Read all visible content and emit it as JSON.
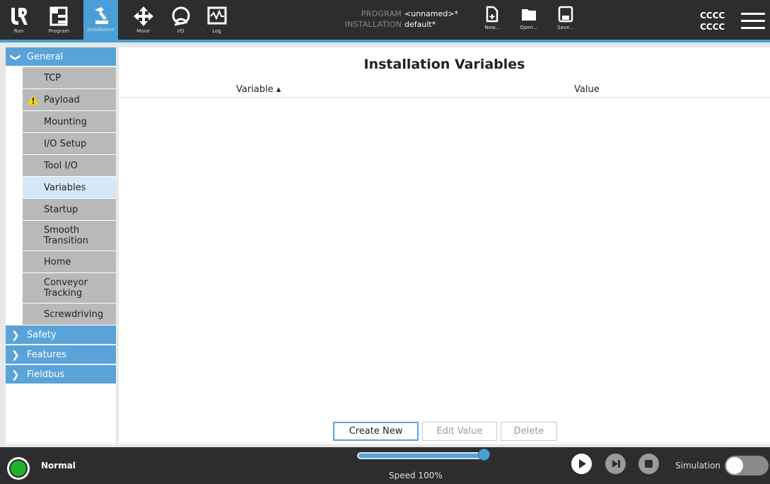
{
  "topbar": {
    "nav": [
      {
        "label": "Run"
      },
      {
        "label": "Program"
      },
      {
        "label": "Installation"
      },
      {
        "label": "Move"
      },
      {
        "label": "I/O"
      },
      {
        "label": "Log"
      }
    ],
    "program_key": "PROGRAM",
    "program_value": "<unnamed>*",
    "installation_key": "INSTALLATION",
    "installation_value": "default*",
    "file": [
      {
        "label": "New..."
      },
      {
        "label": "Open..."
      },
      {
        "label": "Save..."
      }
    ],
    "robot_name_1": "CCCC",
    "robot_name_2": "CCCC"
  },
  "sidebar": {
    "general": "General",
    "items": [
      {
        "label": "TCP"
      },
      {
        "label": "Payload",
        "warning": true
      },
      {
        "label": "Mounting"
      },
      {
        "label": "I/O Setup"
      },
      {
        "label": "Tool I/O"
      },
      {
        "label": "Variables",
        "selected": true
      },
      {
        "label": "Startup"
      },
      {
        "label": "Smooth Transition"
      },
      {
        "label": "Home"
      },
      {
        "label": "Conveyor Tracking"
      },
      {
        "label": "Screwdriving"
      }
    ],
    "groups": [
      {
        "label": "Safety"
      },
      {
        "label": "Features"
      },
      {
        "label": "Fieldbus"
      }
    ]
  },
  "main": {
    "title": "Installation Variables",
    "col_variable": "Variable ▴",
    "col_value": "Value",
    "create_new": "Create New",
    "edit_value": "Edit Value",
    "delete": "Delete"
  },
  "footer": {
    "status": "Normal",
    "speed_label": "Speed 100%",
    "speed_fraction": 1.0,
    "simulation_label": "Simulation",
    "simulation_on": false
  },
  "colors": {
    "accent": "#4a9fd6",
    "bar": "#2d2d2d",
    "status_ok": "#23b02b"
  }
}
